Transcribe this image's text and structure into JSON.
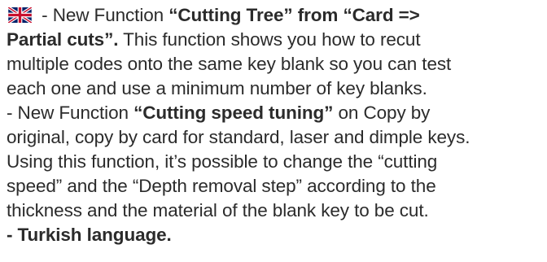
{
  "flag": {
    "icon": "uk-flag-icon"
  },
  "lines": [
    {
      "a": " - New Function ",
      "b": "“Cutting Tree” from “Card =>"
    },
    {
      "a": "Partial cuts”.",
      "b": " This function shows you how to recut"
    },
    {
      "a": "multiple codes onto the same key blank so you can test"
    },
    {
      "a": "each one and use a minimum number of key blanks."
    },
    {
      "a": "- New Function ",
      "b": "“Cutting speed tuning”",
      "c": " on Copy by"
    },
    {
      "a": "original, copy by card for standard, laser and dimple keys."
    },
    {
      "a": "Using this function, it’s possible to change the “cutting"
    },
    {
      "a": "speed” and the “Depth removal step” according to the"
    },
    {
      "a": "thickness and the material of the blank key to be cut."
    },
    {
      "a": "- Turkish language."
    }
  ]
}
